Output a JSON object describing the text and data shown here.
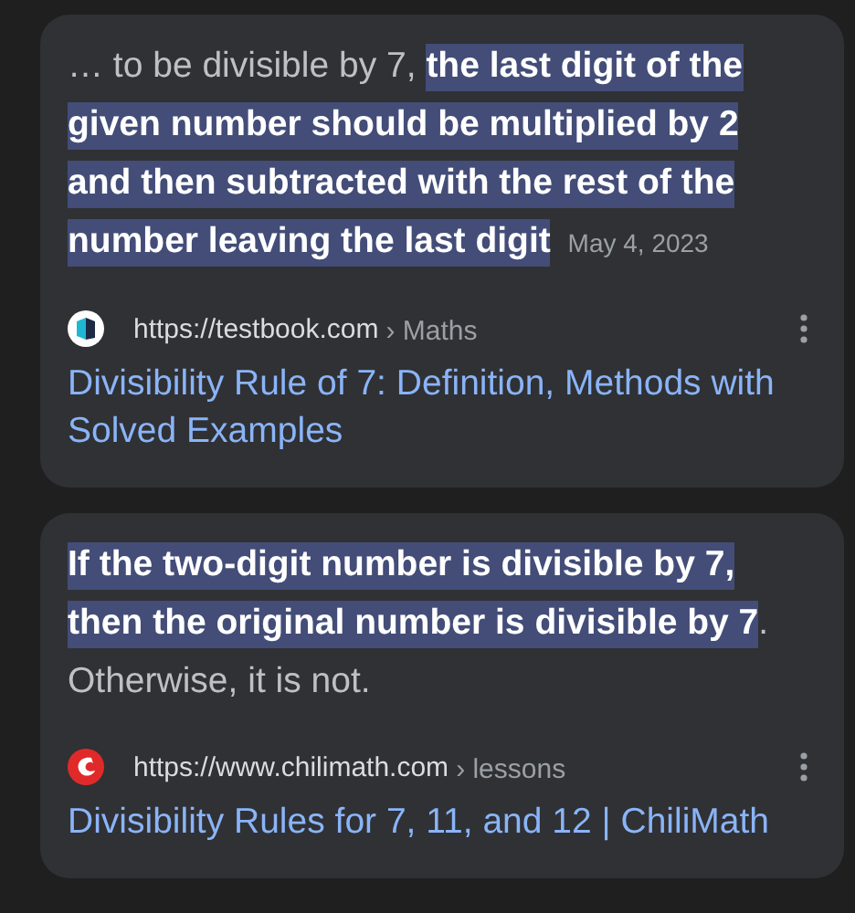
{
  "results": [
    {
      "snippet": "… to be divisible by 7, **the last digit of the given number should be multiplied by 2 and then subtracted with the rest of the number leaving the last digit**",
      "date": "May 4, 2023",
      "url": "https://testbook.com",
      "breadcrumb": "› Maths",
      "title": "Divisibility Rule of 7: Definition, Methods with Solved Examples"
    },
    {
      "snippet": "**If the two-digit number is divisible by 7, then the original number is divisible by 7**. Otherwise, it is not.",
      "url": "https://www.chilimath.com",
      "breadcrumb": "› lessons",
      "title": "Divisibility Rules for 7, 11, and 12 | ChiliMath"
    }
  ]
}
